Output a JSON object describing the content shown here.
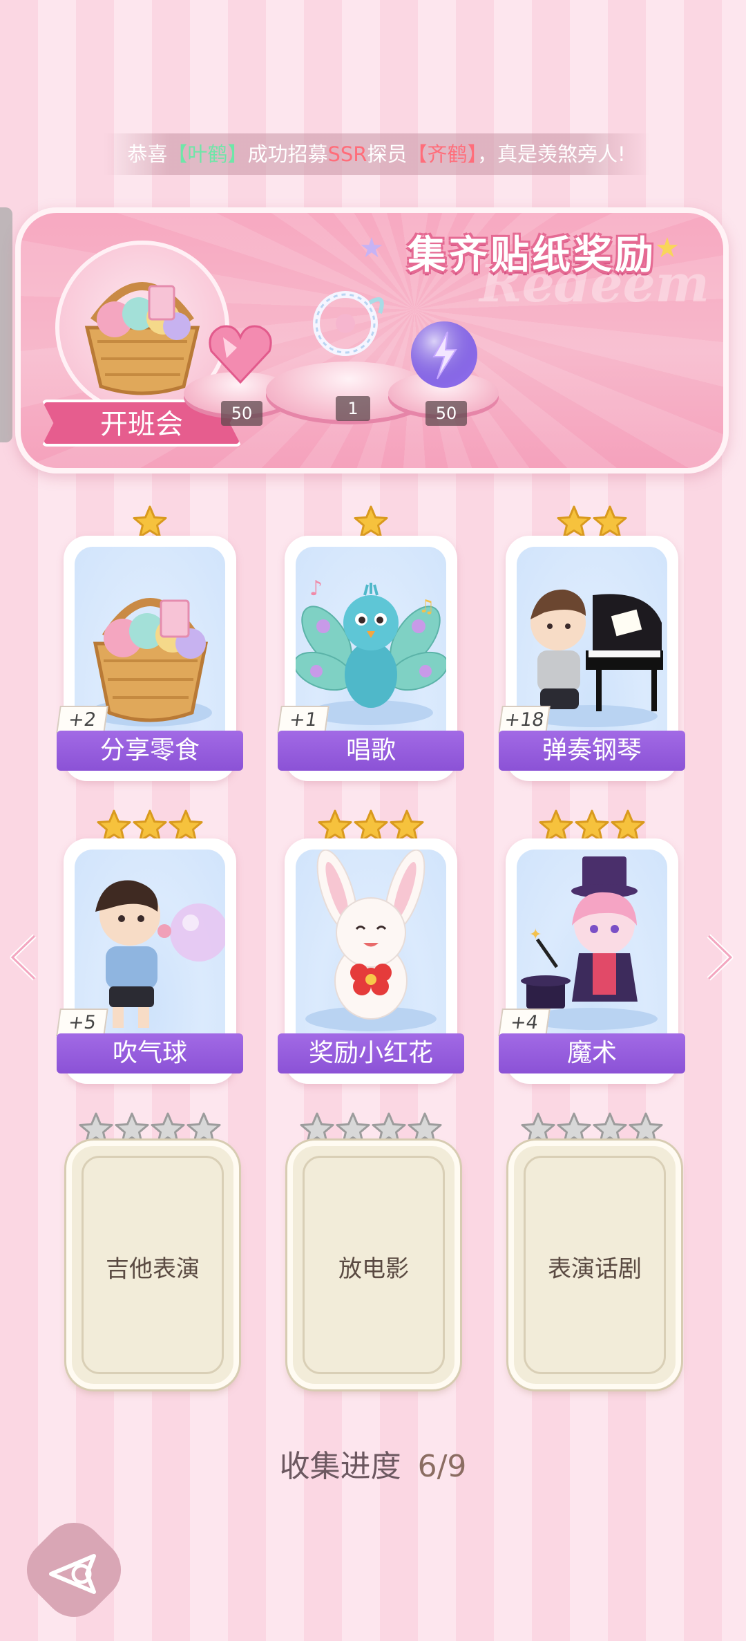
{
  "ticker": {
    "prefix": "恭喜",
    "player": "【叶鹤】",
    "middle1": "成功招募",
    "rarity": "SSR",
    "middle2": "探员",
    "agent": "【齐鹤】",
    "suffix": "，真是羡煞旁人!"
  },
  "banner": {
    "title": "集齐贴纸奖励",
    "watermark": "Redeem",
    "event_label": "开班会",
    "rewards": [
      {
        "name": "heart-gem",
        "count": "50"
      },
      {
        "name": "crystal-ring",
        "count": "1"
      },
      {
        "name": "lightning-orb",
        "count": "50"
      }
    ]
  },
  "cards": [
    {
      "label": "分享零食",
      "bonus": "+2",
      "stars": 1,
      "icon": "snack-basket-icon"
    },
    {
      "label": "唱歌",
      "bonus": "+1",
      "stars": 1,
      "icon": "peacock-singing-icon"
    },
    {
      "label": "弹奏钢琴",
      "bonus": "+18",
      "stars": 2,
      "icon": "piano-boy-icon"
    },
    {
      "label": "吹气球",
      "bonus": "+5",
      "stars": 3,
      "icon": "balloon-boy-icon"
    },
    {
      "label": "奖励小红花",
      "bonus": "",
      "stars": 3,
      "icon": "bunny-flower-icon"
    },
    {
      "label": "魔术",
      "bonus": "+4",
      "stars": 3,
      "icon": "magician-girl-icon"
    }
  ],
  "locked_cards": [
    {
      "label": "吉他表演",
      "stars": 4
    },
    {
      "label": "放电影",
      "stars": 4
    },
    {
      "label": "表演话剧",
      "stars": 4
    }
  ],
  "progress": {
    "label": "收集进度",
    "value": "6/9"
  },
  "colors": {
    "accent_pink": "#e65d8e",
    "label_purple": "#9a62e0",
    "star_gold": "#f6c23d"
  }
}
